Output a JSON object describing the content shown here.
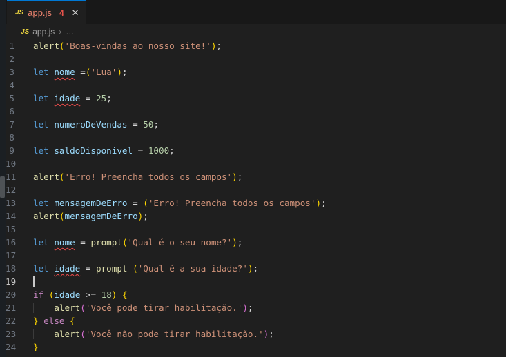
{
  "tab": {
    "icon": "JS",
    "label": "app.js",
    "error_count": "4",
    "close_glyph": "✕"
  },
  "breadcrumb": {
    "icon": "JS",
    "file": "app.js",
    "separator": "›",
    "more": "…"
  },
  "colors": {
    "accent": "#0078d4",
    "editor_bg": "#1f1f1f",
    "tabbar_bg": "#181818",
    "tab_error_label": "#f48771",
    "error_squiggle": "#f14c4c",
    "keyword": "#569cd6",
    "control": "#c586c0",
    "variable": "#9cdcfe",
    "function": "#dcdcaa",
    "string": "#ce9178",
    "number": "#b5cea8",
    "operator": "#d4d4d4",
    "bracket_level1": "#ffd700",
    "bracket_level2": "#da70d6",
    "line_number": "#6e7681",
    "line_number_active": "#c6c6c6"
  },
  "editor": {
    "language": "javascript",
    "active_line": 19,
    "lines": [
      {
        "n": 1,
        "tokens": [
          {
            "t": "alert",
            "c": "fn"
          },
          {
            "t": "(",
            "c": "b1"
          },
          {
            "t": "'Boas-vindas ao nosso site!'",
            "c": "str"
          },
          {
            "t": ")",
            "c": "b1"
          },
          {
            "t": ";",
            "c": "op"
          }
        ]
      },
      {
        "n": 2,
        "tokens": []
      },
      {
        "n": 3,
        "tokens": [
          {
            "t": "let",
            "c": "kw"
          },
          {
            "t": " ",
            "c": "op"
          },
          {
            "t": "nome",
            "c": "var",
            "sq": true
          },
          {
            "t": " =",
            "c": "op"
          },
          {
            "t": "(",
            "c": "b1"
          },
          {
            "t": "'Lua'",
            "c": "str"
          },
          {
            "t": ")",
            "c": "b1"
          },
          {
            "t": ";",
            "c": "op"
          }
        ]
      },
      {
        "n": 4,
        "tokens": []
      },
      {
        "n": 5,
        "tokens": [
          {
            "t": "let",
            "c": "kw"
          },
          {
            "t": " ",
            "c": "op"
          },
          {
            "t": "idade",
            "c": "var",
            "sq": true
          },
          {
            "t": " = ",
            "c": "op"
          },
          {
            "t": "25",
            "c": "num"
          },
          {
            "t": ";",
            "c": "op"
          }
        ]
      },
      {
        "n": 6,
        "tokens": []
      },
      {
        "n": 7,
        "tokens": [
          {
            "t": "let",
            "c": "kw"
          },
          {
            "t": " ",
            "c": "op"
          },
          {
            "t": "numeroDeVendas",
            "c": "var"
          },
          {
            "t": " = ",
            "c": "op"
          },
          {
            "t": "50",
            "c": "num"
          },
          {
            "t": ";",
            "c": "op"
          }
        ]
      },
      {
        "n": 8,
        "tokens": []
      },
      {
        "n": 9,
        "tokens": [
          {
            "t": "let",
            "c": "kw"
          },
          {
            "t": " ",
            "c": "op"
          },
          {
            "t": "saldoDisponivel",
            "c": "var"
          },
          {
            "t": " = ",
            "c": "op"
          },
          {
            "t": "1000",
            "c": "num"
          },
          {
            "t": ";",
            "c": "op"
          }
        ]
      },
      {
        "n": 10,
        "tokens": []
      },
      {
        "n": 11,
        "tokens": [
          {
            "t": "alert",
            "c": "fn"
          },
          {
            "t": "(",
            "c": "b1"
          },
          {
            "t": "'Erro! Preencha todos os campos'",
            "c": "str"
          },
          {
            "t": ")",
            "c": "b1"
          },
          {
            "t": ";",
            "c": "op"
          }
        ]
      },
      {
        "n": 12,
        "tokens": []
      },
      {
        "n": 13,
        "tokens": [
          {
            "t": "let",
            "c": "kw"
          },
          {
            "t": " ",
            "c": "op"
          },
          {
            "t": "mensagemDeErro",
            "c": "var"
          },
          {
            "t": " = ",
            "c": "op"
          },
          {
            "t": "(",
            "c": "b1"
          },
          {
            "t": "'Erro! Preencha todos os campos'",
            "c": "str"
          },
          {
            "t": ")",
            "c": "b1"
          },
          {
            "t": ";",
            "c": "op"
          }
        ]
      },
      {
        "n": 14,
        "tokens": [
          {
            "t": "alert",
            "c": "fn"
          },
          {
            "t": "(",
            "c": "b1"
          },
          {
            "t": "mensagemDeErro",
            "c": "var"
          },
          {
            "t": ")",
            "c": "b1"
          },
          {
            "t": ";",
            "c": "op"
          }
        ]
      },
      {
        "n": 15,
        "tokens": []
      },
      {
        "n": 16,
        "tokens": [
          {
            "t": "let",
            "c": "kw"
          },
          {
            "t": " ",
            "c": "op"
          },
          {
            "t": "nome",
            "c": "var",
            "sq": true
          },
          {
            "t": " = ",
            "c": "op"
          },
          {
            "t": "prompt",
            "c": "fn"
          },
          {
            "t": "(",
            "c": "b1"
          },
          {
            "t": "'Qual é o seu nome?'",
            "c": "str"
          },
          {
            "t": ")",
            "c": "b1"
          },
          {
            "t": ";",
            "c": "op"
          }
        ]
      },
      {
        "n": 17,
        "tokens": []
      },
      {
        "n": 18,
        "tokens": [
          {
            "t": "let",
            "c": "kw"
          },
          {
            "t": " ",
            "c": "op"
          },
          {
            "t": "idade",
            "c": "var",
            "sq": true
          },
          {
            "t": " = ",
            "c": "op"
          },
          {
            "t": "prompt",
            "c": "fn"
          },
          {
            "t": " ",
            "c": "op"
          },
          {
            "t": "(",
            "c": "b1"
          },
          {
            "t": "'Qual é a sua idade?'",
            "c": "str"
          },
          {
            "t": ")",
            "c": "b1"
          },
          {
            "t": ";",
            "c": "op"
          }
        ]
      },
      {
        "n": 19,
        "tokens": [],
        "cursor": true
      },
      {
        "n": 20,
        "tokens": [
          {
            "t": "if",
            "c": "ctrl"
          },
          {
            "t": " ",
            "c": "op"
          },
          {
            "t": "(",
            "c": "b1"
          },
          {
            "t": "idade",
            "c": "var"
          },
          {
            "t": " >= ",
            "c": "op"
          },
          {
            "t": "18",
            "c": "num"
          },
          {
            "t": ")",
            "c": "b1"
          },
          {
            "t": " ",
            "c": "op"
          },
          {
            "t": "{",
            "c": "b1"
          }
        ]
      },
      {
        "n": 21,
        "tokens": [
          {
            "t": "    ",
            "c": "op",
            "guide": true
          },
          {
            "t": "alert",
            "c": "fn"
          },
          {
            "t": "(",
            "c": "b2"
          },
          {
            "t": "'Você pode tirar habilitação.'",
            "c": "str"
          },
          {
            "t": ")",
            "c": "b2"
          },
          {
            "t": ";",
            "c": "op"
          }
        ]
      },
      {
        "n": 22,
        "tokens": [
          {
            "t": "}",
            "c": "b1"
          },
          {
            "t": " ",
            "c": "op"
          },
          {
            "t": "else",
            "c": "ctrl"
          },
          {
            "t": " ",
            "c": "op"
          },
          {
            "t": "{",
            "c": "b1"
          }
        ]
      },
      {
        "n": 23,
        "tokens": [
          {
            "t": "    ",
            "c": "op",
            "guide": true
          },
          {
            "t": "alert",
            "c": "fn"
          },
          {
            "t": "(",
            "c": "b2"
          },
          {
            "t": "'Você não pode tirar habilitação.'",
            "c": "str"
          },
          {
            "t": ")",
            "c": "b2"
          },
          {
            "t": ";",
            "c": "op"
          }
        ]
      },
      {
        "n": 24,
        "tokens": [
          {
            "t": "}",
            "c": "b1"
          }
        ]
      }
    ]
  }
}
